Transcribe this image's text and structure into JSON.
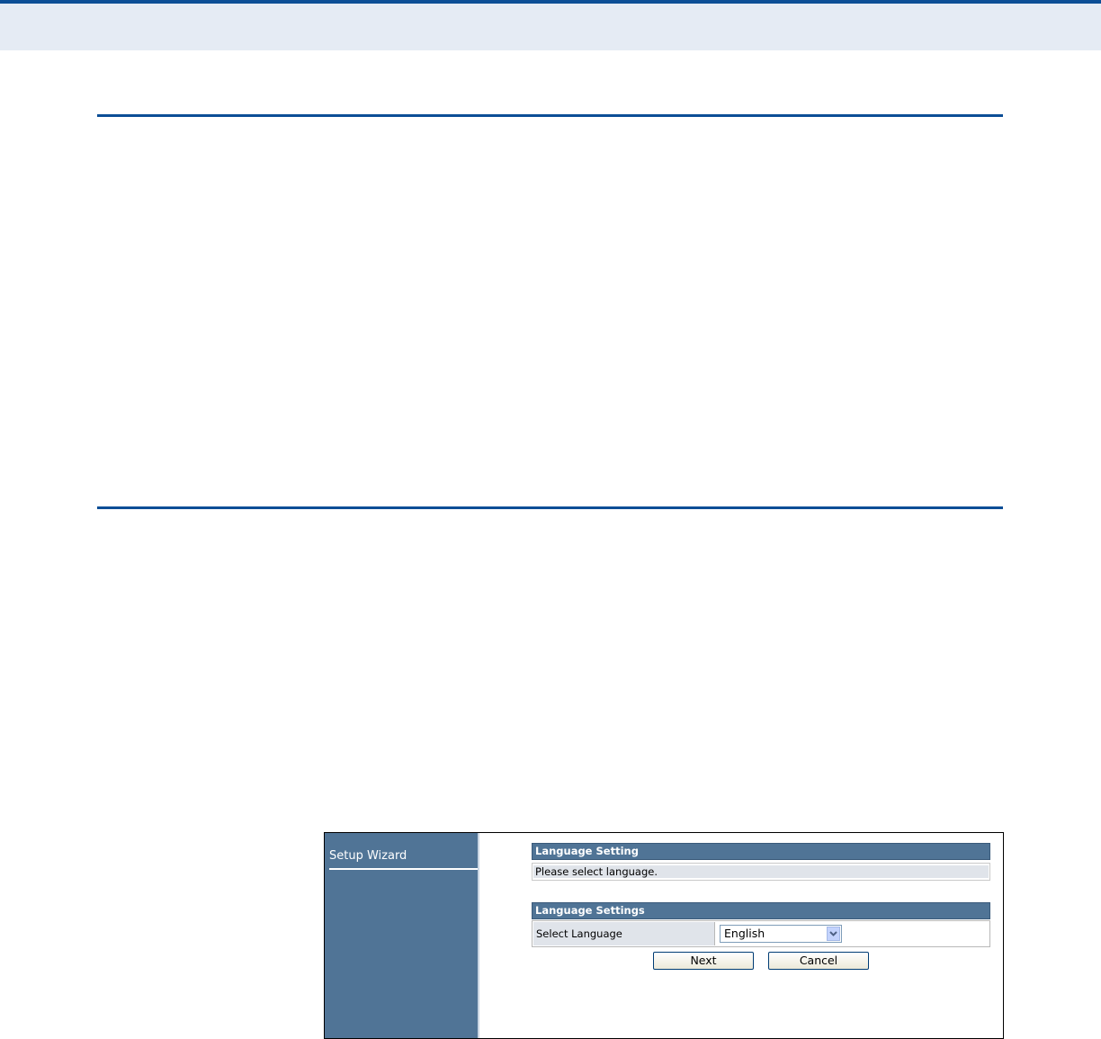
{
  "wizard": {
    "sidebar_title": "Setup Wizard",
    "panel1": {
      "header": "Language Setting",
      "message": "Please select language."
    },
    "panel2": {
      "header": "Language Settings",
      "row_label": "Select Language",
      "selected_language": "English"
    },
    "buttons": {
      "next": "Next",
      "cancel": "Cancel"
    }
  },
  "colors": {
    "accent_rule": "#0c4e96",
    "sidebar": "#507496",
    "header_band": "#e5ebf4"
  },
  "icons": {
    "select_arrow": "chevron-down-icon"
  }
}
